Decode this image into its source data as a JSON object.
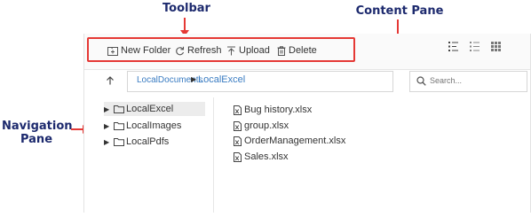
{
  "annotations": {
    "toolbar": "Toolbar",
    "content_pane": "Content Pane",
    "navigation_pane_line1": "Navigation",
    "navigation_pane_line2": "Pane",
    "arrow_color": "#e53935",
    "label_color": "#1d2a6e"
  },
  "toolbar": {
    "new_folder": "New Folder",
    "refresh": "Refresh",
    "upload": "Upload",
    "delete": "Delete",
    "view_icons": [
      "details-view-icon",
      "list-view-icon",
      "large-icons-view-icon"
    ]
  },
  "breadcrumb": {
    "items": [
      "LocalDocuments",
      "LocalExcel"
    ]
  },
  "search": {
    "placeholder": "Search..."
  },
  "navigation": {
    "items": [
      {
        "label": "LocalExcel",
        "selected": true
      },
      {
        "label": "LocalImages",
        "selected": false
      },
      {
        "label": "LocalPdfs",
        "selected": false
      }
    ]
  },
  "content": {
    "files": [
      "Bug history.xlsx",
      "group.xlsx",
      "OrderManagement.xlsx",
      "Sales.xlsx"
    ]
  },
  "colors": {
    "accent": "#3a7cc2",
    "highlight_box": "#e53935",
    "selected_bg": "#ececec"
  }
}
